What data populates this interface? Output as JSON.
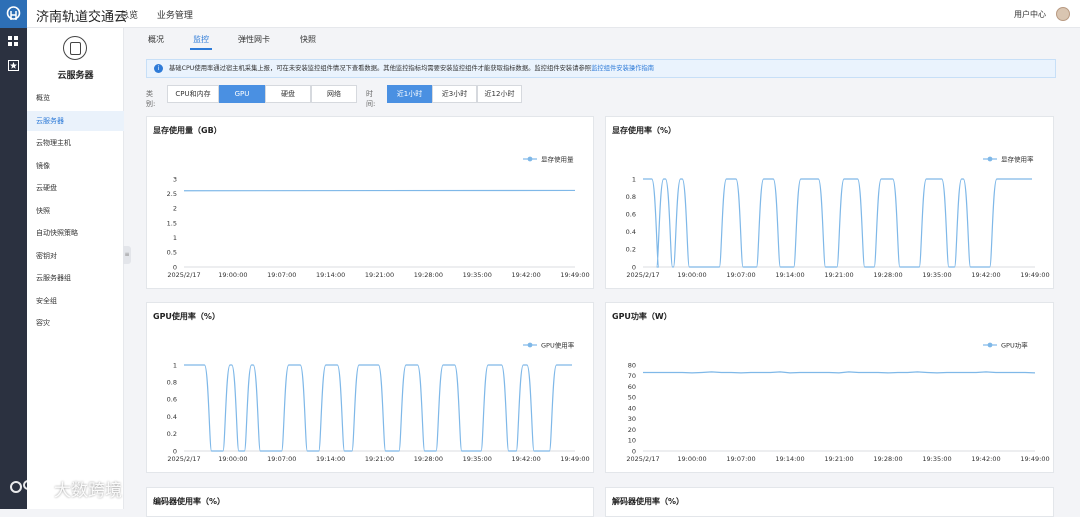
{
  "app": {
    "title": "济南轨道交通云",
    "user_center": "用户中心"
  },
  "topnav": [
    "总览",
    "业务管理"
  ],
  "sidebar": {
    "title": "云服务器",
    "items": [
      {
        "label": "概览"
      },
      {
        "label": "云服务器",
        "active": true
      },
      {
        "label": "云物理主机"
      },
      {
        "label": "镜像"
      },
      {
        "label": "云硬盘"
      },
      {
        "label": "快照"
      },
      {
        "label": "自动快照策略"
      },
      {
        "label": "密钥对"
      },
      {
        "label": "云服务器组"
      },
      {
        "label": "安全组"
      },
      {
        "label": "容灾"
      }
    ]
  },
  "tabs": [
    {
      "label": "概况"
    },
    {
      "label": "监控",
      "active": true
    },
    {
      "label": "弹性网卡"
    },
    {
      "label": "快照"
    }
  ],
  "info": {
    "text": "基础CPU使用率通过宿主机采集上报，可在未安装监控组件情况下查看数据。其他监控指标均需要安装监控组件才能获取指标数据。监控组件安装请参照",
    "link": "监控组件安装操作指南"
  },
  "filters": {
    "category_label": "类别:",
    "categories": [
      {
        "label": "CPU和内存"
      },
      {
        "label": "GPU",
        "active": true
      },
      {
        "label": "硬盘"
      },
      {
        "label": "网络"
      }
    ],
    "time_label": "时间:",
    "times": [
      {
        "label": "近1小时",
        "active": true
      },
      {
        "label": "近3小时"
      },
      {
        "label": "近12小时"
      }
    ]
  },
  "colors": {
    "accent": "#2e7bd8",
    "series": "#7fb8e8",
    "active_button": "#4a90e2",
    "info_bg": "#eaf3fd"
  },
  "x_labels": [
    "2025/2/17",
    "19:00:00",
    "19:07:00",
    "19:14:00",
    "19:21:00",
    "19:28:00",
    "19:35:00",
    "19:42:00",
    "19:49:00"
  ],
  "chart_data": [
    {
      "type": "line",
      "title": "显存使用量（GB）",
      "series": [
        {
          "name": "显存使用量",
          "pattern": "flat",
          "values": [
            2.6
          ]
        }
      ],
      "y_ticks": [
        "0",
        "0.5",
        "1",
        "1.5",
        "2",
        "2.5",
        "3"
      ],
      "ylim": [
        0,
        3
      ],
      "x_labels_ref": "x_labels"
    },
    {
      "type": "line",
      "title": "显存使用率（%）",
      "series": [
        {
          "name": "显存使用率",
          "pattern": "pulse_a",
          "values": [
            1,
            0,
            1,
            0,
            1,
            0,
            1,
            0,
            1,
            0,
            1,
            0,
            1,
            0,
            1,
            0,
            1,
            0,
            1,
            0,
            1
          ]
        }
      ],
      "y_ticks": [
        "0",
        "0.2",
        "0.4",
        "0.6",
        "0.8",
        "1"
      ],
      "ylim": [
        0,
        1
      ]
    },
    {
      "type": "line",
      "title": "GPU使用率（%）",
      "series": [
        {
          "name": "GPU使用率",
          "pattern": "pulse_b",
          "values": [
            1,
            0,
            1,
            0,
            1,
            0,
            1,
            0,
            1,
            0,
            1,
            0,
            1,
            0,
            1,
            0,
            1,
            0,
            1,
            0,
            1
          ]
        }
      ],
      "y_ticks": [
        "0",
        "0.2",
        "0.4",
        "0.6",
        "0.8",
        "1"
      ],
      "ylim": [
        0,
        1
      ]
    },
    {
      "type": "line",
      "title": "GPU功率（W）",
      "series": [
        {
          "name": "GPU功率",
          "pattern": "flat",
          "values": [
            73
          ]
        }
      ],
      "y_ticks": [
        "0",
        "10",
        "20",
        "30",
        "40",
        "50",
        "60",
        "70",
        "80"
      ],
      "ylim": [
        0,
        80
      ]
    }
  ],
  "bottom_cards": [
    {
      "title": "编码器使用率（%）"
    },
    {
      "title": "解码器使用率（%）"
    }
  ],
  "watermark": {
    "text": "大数跨境"
  }
}
